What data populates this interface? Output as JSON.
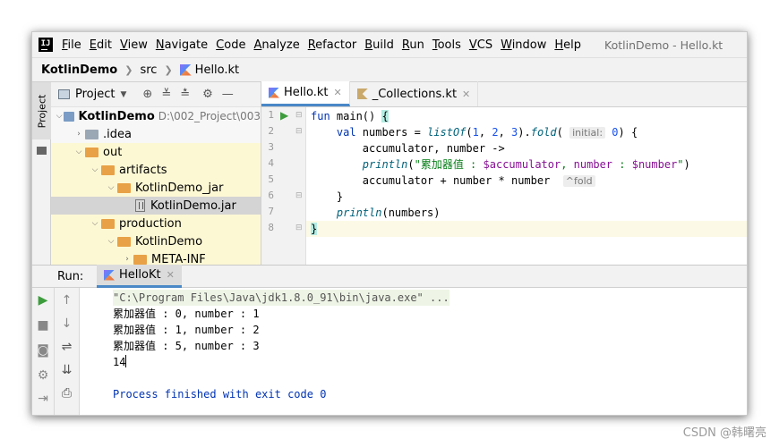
{
  "window": {
    "title": "KotlinDemo - Hello.kt",
    "logo_text": "IJ"
  },
  "menu": [
    "File",
    "Edit",
    "View",
    "Navigate",
    "Code",
    "Analyze",
    "Refactor",
    "Build",
    "Run",
    "Tools",
    "VCS",
    "Window",
    "Help"
  ],
  "breadcrumb": {
    "project": "KotlinDemo",
    "folder": "src",
    "file": "Hello.kt"
  },
  "sidebar": {
    "tab_label": "Project"
  },
  "project_panel": {
    "header_label": "Project",
    "tree": [
      {
        "label": "KotlinDemo",
        "path": "D:\\002_Project\\003",
        "icon": "module-folder",
        "expanded": true,
        "bold": true
      },
      {
        "label": ".idea",
        "icon": "folder-gray",
        "expanded": false
      },
      {
        "label": "out",
        "icon": "folder-orange",
        "expanded": true
      },
      {
        "label": "artifacts",
        "icon": "folder-orange",
        "expanded": true
      },
      {
        "label": "KotlinDemo_jar",
        "icon": "folder-orange",
        "expanded": true
      },
      {
        "label": "KotlinDemo.jar",
        "icon": "jar-file",
        "selected": true
      },
      {
        "label": "production",
        "icon": "folder-orange",
        "expanded": true
      },
      {
        "label": "KotlinDemo",
        "icon": "folder-orange",
        "expanded": true
      },
      {
        "label": "META-INF",
        "icon": "folder-orange",
        "expanded": false
      }
    ]
  },
  "editor": {
    "tabs": [
      {
        "label": "Hello.kt",
        "active": true
      },
      {
        "label": "_Collections.kt",
        "active": false
      }
    ],
    "line_numbers": [
      "1",
      "2",
      "3",
      "4",
      "5",
      "6",
      "7",
      "8"
    ],
    "code": {
      "l1_fun": "fun",
      "l1_main": " main() ",
      "l1_brace": "{",
      "l2_val": "    val",
      "l2_rest": " numbers = ",
      "l2_listof": "listOf",
      "l2_args": "(",
      "l2_n1": "1",
      "l2_c1": ", ",
      "l2_n2": "2",
      "l2_c2": ", ",
      "l2_n3": "3",
      "l2_close": ").",
      "l2_fold": "fold",
      "l2_open": "( ",
      "l2_hint": "initial:",
      "l2_n0": " 0",
      "l2_tail": ") {",
      "l3": "        accumulator, number ->",
      "l4_println": "        println",
      "l4_open": "(",
      "l4_str1": "\"累加器值 : ",
      "l4_tpl1": "$accumulator",
      "l4_str2": ", ",
      "l4_number": "number",
      "l4_str3": " : ",
      "l4_tpl2": "$number",
      "l4_str4": "\"",
      "l4_close": ")",
      "l5": "        accumulator + number * number  ",
      "l5_hint": "^fold",
      "l6": "    }",
      "l7_println": "    println",
      "l7_rest": "(numbers)",
      "l8_brace": "}"
    }
  },
  "run_panel": {
    "label": "Run:",
    "tab_label": "HelloKt",
    "output": [
      "\"C:\\Program Files\\Java\\jdk1.8.0_91\\bin\\java.exe\" ...",
      "累加器值 : 0, number : 1",
      "累加器值 : 1, number : 2",
      "累加器值 : 5, number : 3",
      "14",
      "Process finished with exit code 0"
    ]
  },
  "watermark": "CSDN @韩曙亮"
}
